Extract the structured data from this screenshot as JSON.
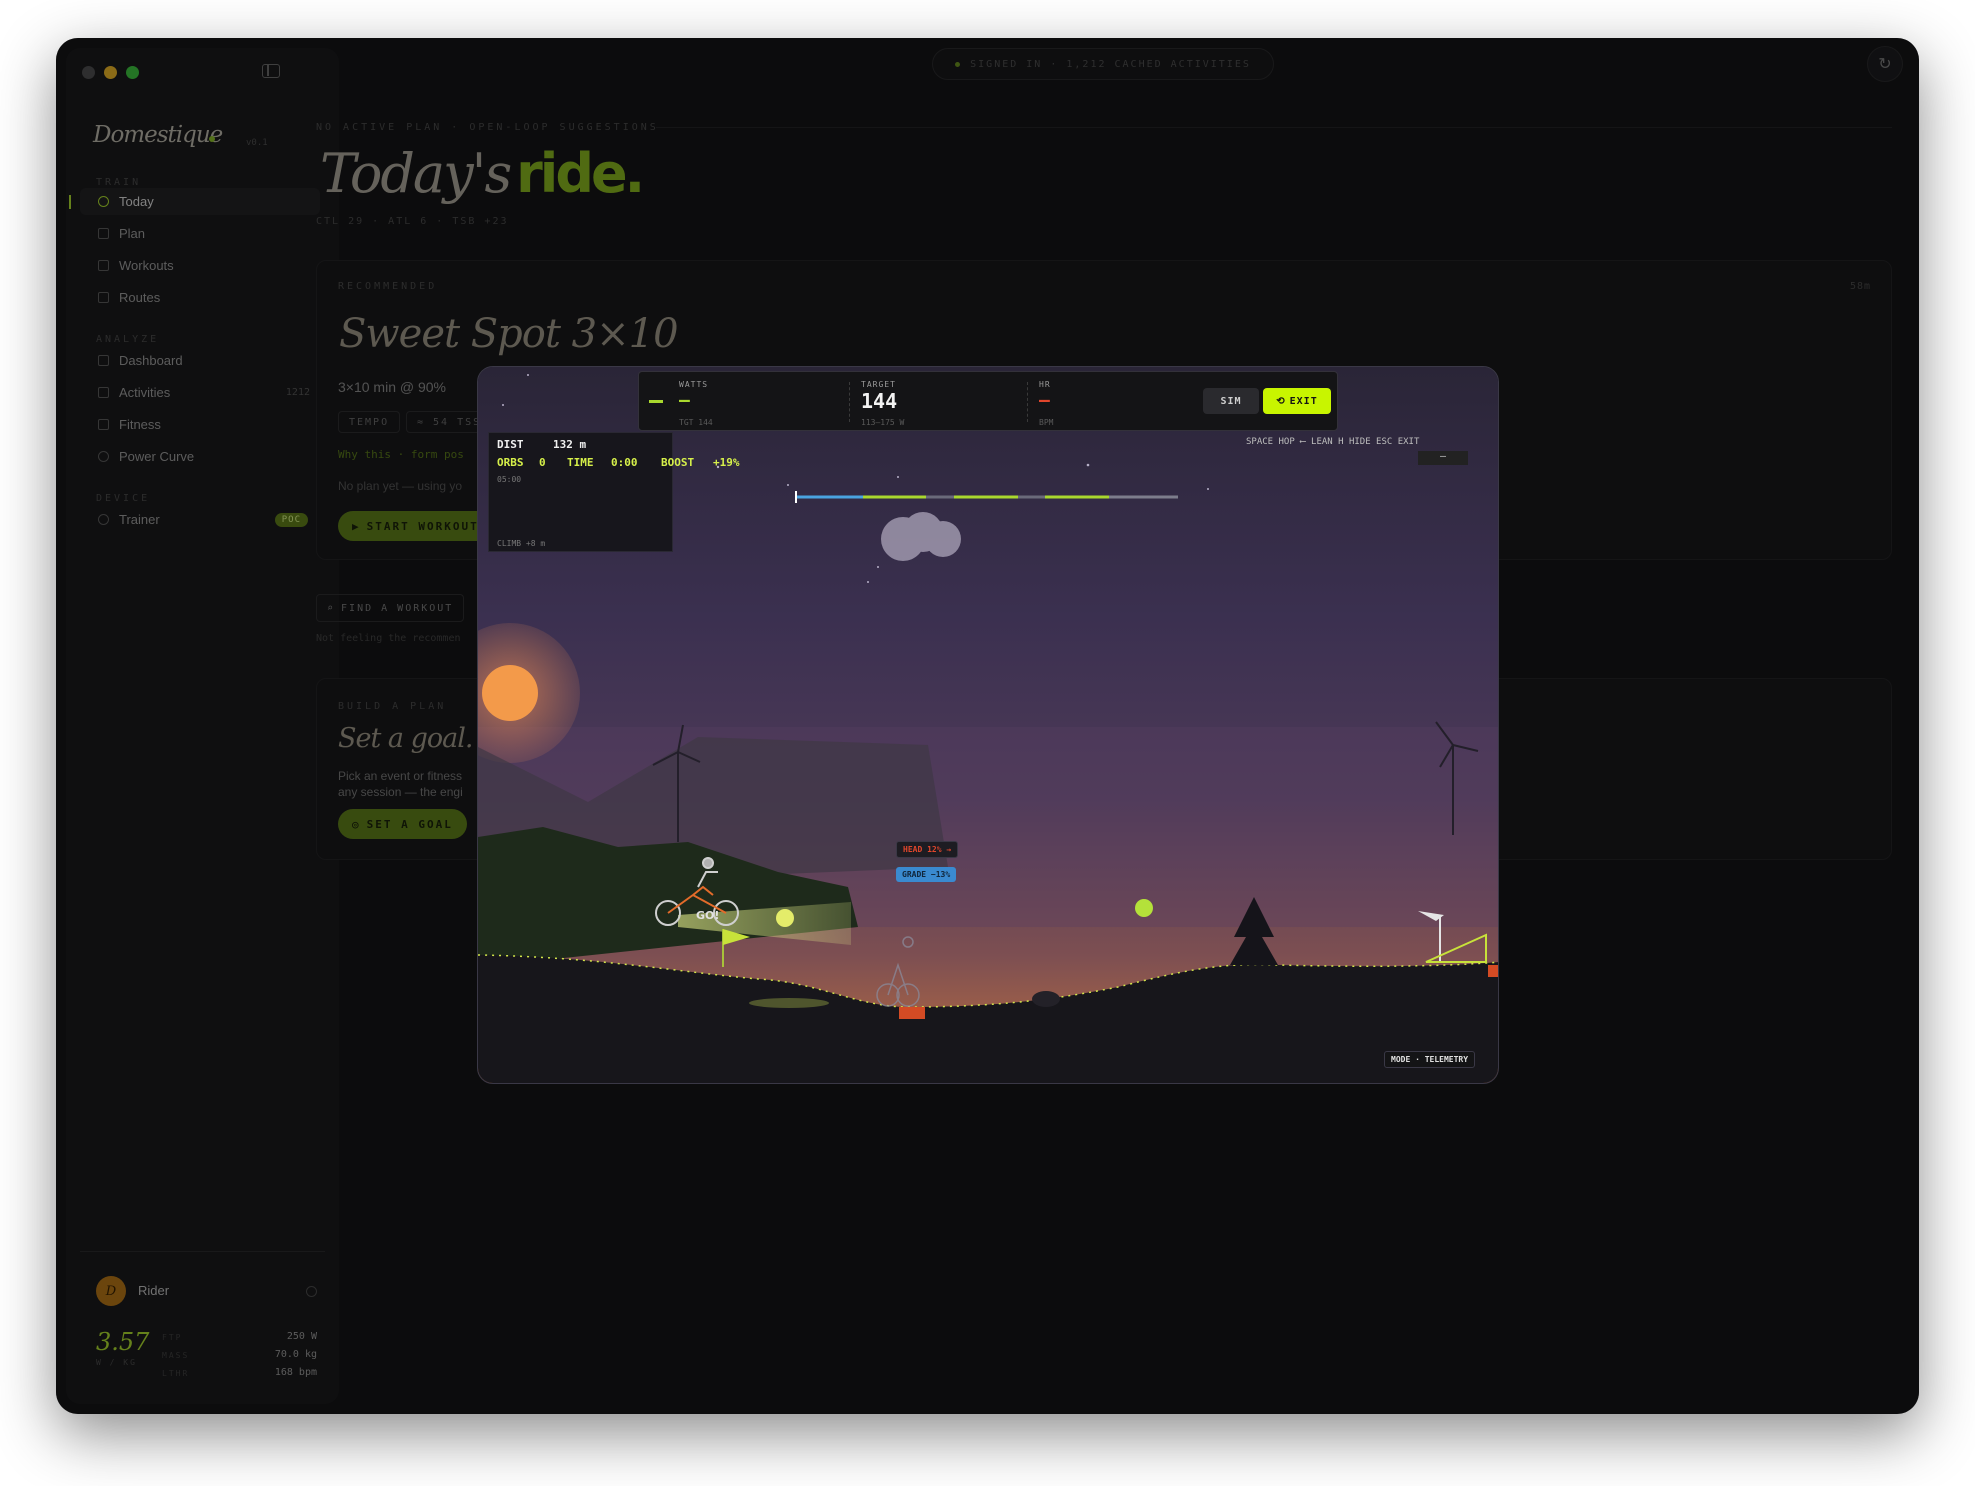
{
  "status_banner": "SIGNED IN · 1,212 CACHED ACTIVITIES",
  "sidebar": {
    "brand": "Domestique",
    "version": "v0.1",
    "sections": [
      {
        "title": "TRAIN"
      },
      {
        "title": "ANALYZE"
      },
      {
        "title": "DEVICE"
      }
    ],
    "items": [
      {
        "label": "Today",
        "icon": "sun-icon"
      },
      {
        "label": "Plan",
        "icon": "calendar-icon"
      },
      {
        "label": "Workouts",
        "icon": "list-icon"
      },
      {
        "label": "Routes",
        "icon": "map-icon"
      },
      {
        "label": "Dashboard",
        "icon": "grid-icon"
      },
      {
        "label": "Activities",
        "icon": "list-icon",
        "count": "1212"
      },
      {
        "label": "Fitness",
        "icon": "chart-icon"
      },
      {
        "label": "Power Curve",
        "icon": "bolt-icon"
      },
      {
        "label": "Trainer",
        "icon": "signal-icon",
        "badge": "POC"
      }
    ],
    "user": {
      "avatar_letter": "D",
      "name": "Rider",
      "wkg": "3.57",
      "wkg_label": "W / KG",
      "stats": [
        {
          "label": "FTP",
          "value": "250 W"
        },
        {
          "label": "MASS",
          "value": "70.0 kg"
        },
        {
          "label": "LTHR",
          "value": "168 bpm"
        }
      ]
    }
  },
  "main": {
    "plan_status": "NO ACTIVE PLAN · OPEN-LOOP SUGGESTIONS",
    "title_a": "Today's",
    "title_b": "ride.",
    "metrics": "CTL 29 · ATL 6 · TSB +23",
    "recommended": {
      "label": "RECOMMENDED",
      "duration": "58m",
      "name": "Sweet Spot 3×10",
      "detail": "3×10 min @ 90%",
      "tags": [
        "TEMPO",
        "≈ 54 TSS"
      ],
      "why": "Why this · form pos",
      "note": "No plan yet — using yo",
      "start": "START WORKOUT"
    },
    "find": {
      "label": "FIND A WORKOUT",
      "note": "Not feeling the recommen"
    },
    "goal": {
      "label": "BUILD A PLAN",
      "title": "Set a goal.",
      "desc_1": "Pick an event or fitness",
      "desc_2": "any session — the engi",
      "button": "SET A GOAL"
    }
  },
  "game": {
    "hud": {
      "watts_label": "WATTS",
      "watts_value": "—",
      "watts_sub": "TGT 144",
      "target_label": "TARGET",
      "target_value": "144",
      "target_sub": "113–175 W",
      "hr_label": "HR",
      "hr_value": "—",
      "hr_sub": "BPM",
      "sim": "SIM",
      "exit": "EXIT"
    },
    "hints": "SPACE HOP   ⟵ LEAN   H HIDE   ESC EXIT",
    "hint_value": "—",
    "panel": {
      "dist_label": "DIST",
      "dist_value": "132 m",
      "orbs_label": "ORBS",
      "orbs_value": "0",
      "time_label": "TIME",
      "time_value": "0:00",
      "boost_label": "BOOST",
      "boost_value": "+19%",
      "interval": "05:00",
      "climb": "CLIMB  +8 m"
    },
    "head_badge": "HEAD 12% →",
    "grade_badge": "GRADE −13%",
    "go_text": "GO!",
    "mode_badge": "MODE · TELEMETRY"
  },
  "colors": {
    "accent": "#a9d82e",
    "exit_button": "#c8f500",
    "sun": "#f39a4a",
    "hr": "#e0462c",
    "grade": "#3a8ad0"
  }
}
